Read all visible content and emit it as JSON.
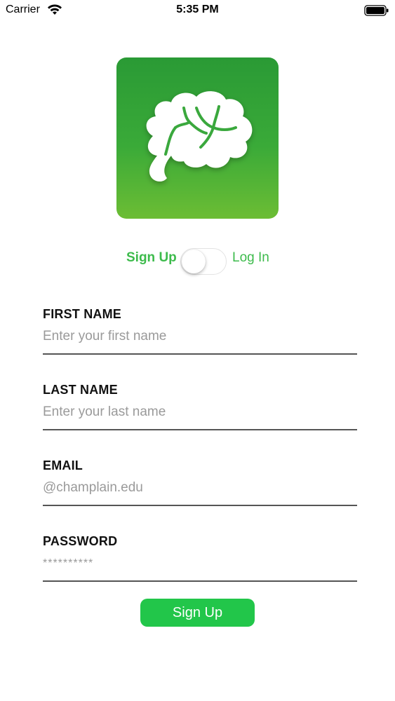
{
  "status_bar": {
    "carrier": "Carrier",
    "time": "5:35 PM",
    "wifi_icon": "wifi-icon",
    "battery_icon": "battery-icon"
  },
  "logo": {
    "icon": "brain-icon",
    "colors": {
      "gradient_top": "#2a9a35",
      "gradient_bottom": "#6cbd34",
      "brain": "#ffffff",
      "brain_lines": "#3aa83d"
    }
  },
  "mode_toggle": {
    "signup_label": "Sign Up",
    "login_label": "Log In",
    "is_login": false
  },
  "form": {
    "first_name": {
      "label": "FIRST NAME",
      "value": "",
      "placeholder": "Enter your first name"
    },
    "last_name": {
      "label": "LAST NAME",
      "value": "",
      "placeholder": "Enter your last name"
    },
    "email": {
      "label": "EMAIL",
      "value": "",
      "placeholder": "@champlain.edu"
    },
    "password": {
      "label": "PASSWORD",
      "value": "",
      "placeholder": "**********"
    }
  },
  "submit": {
    "label": "Sign Up"
  },
  "colors": {
    "accent": "#3dbb4c",
    "button": "#22c64a"
  }
}
